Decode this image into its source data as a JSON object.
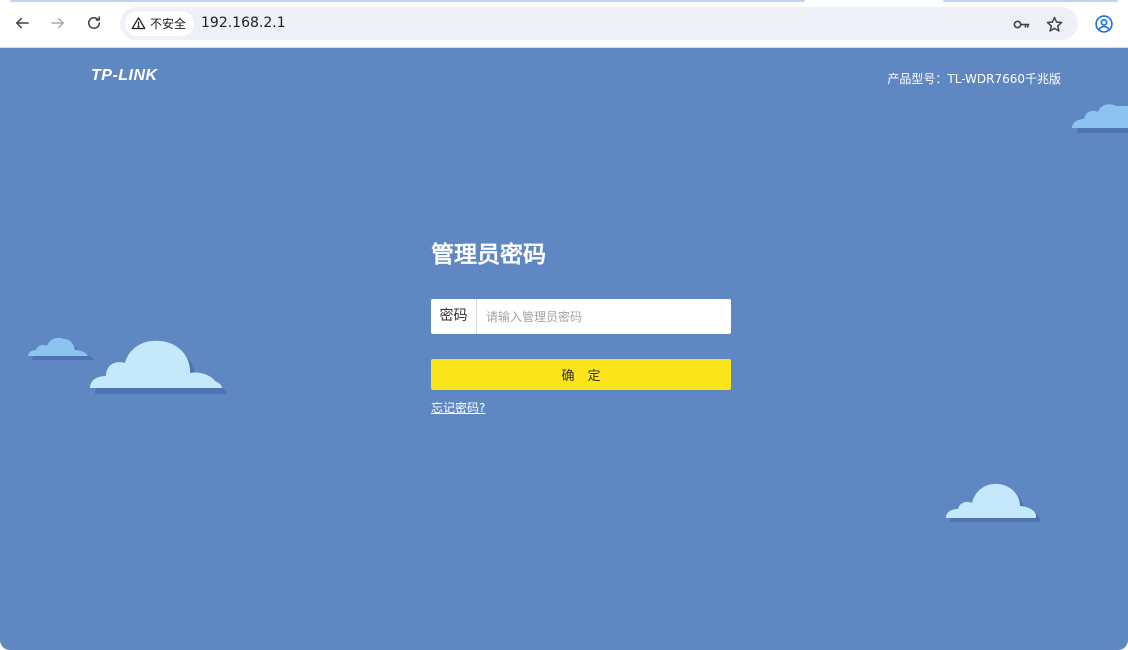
{
  "browser": {
    "security_label": "不安全",
    "url": "192.168.2.1"
  },
  "header": {
    "brand": "TP-LINK",
    "model_info": "产品型号：TL-WDR7660千兆版"
  },
  "login": {
    "title": "管理员密码",
    "password_label": "密码",
    "password_placeholder": "请输入管理员密码",
    "password_value": "",
    "confirm_button": "确　定",
    "forgot_link": "忘记密码?"
  },
  "colors": {
    "page_background": "#5f87c2",
    "confirm_button": "#fbe419",
    "cloud_light": "#c5e9fb",
    "cloud_mid": "#8dc3ef",
    "cloud_shadow": "#4e73b3"
  }
}
